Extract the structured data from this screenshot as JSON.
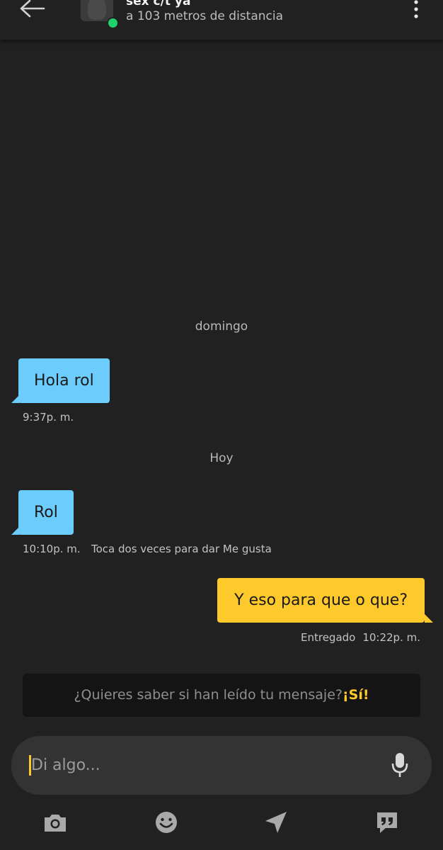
{
  "header": {
    "name": "sex c/t ya",
    "distance": "a 103 metros de distancia",
    "icons": {
      "back": "back-arrow-icon",
      "more": "more-vert-icon"
    },
    "online_color": "#20d26b"
  },
  "conversation": {
    "day_1": "domingo",
    "msg_1": {
      "text": "Hola rol",
      "time": "9:37p. m."
    },
    "day_2": "Hoy",
    "msg_2": {
      "text": "Rol",
      "time": "10:10p. m.",
      "hint": "Toca dos veces para dar Me gusta"
    },
    "msg_3": {
      "text": "Y eso para que o que?",
      "status": "Entregado",
      "time": "10:22p. m."
    }
  },
  "read_banner": {
    "question": "¿Quieres saber si han leído tu mensaje?",
    "cta": "¡Sí!"
  },
  "composer": {
    "placeholder": "Di algo...",
    "mic_icon": "microphone-icon"
  },
  "toolbar": {
    "icons": [
      "camera-icon",
      "emoji-icon",
      "location-send-icon",
      "saved-phrases-icon"
    ]
  },
  "colors": {
    "background": "#212121",
    "incoming_bubble": "#6ccdfd",
    "outgoing_bubble": "#fdc92b",
    "accent": "#fdc92b"
  }
}
